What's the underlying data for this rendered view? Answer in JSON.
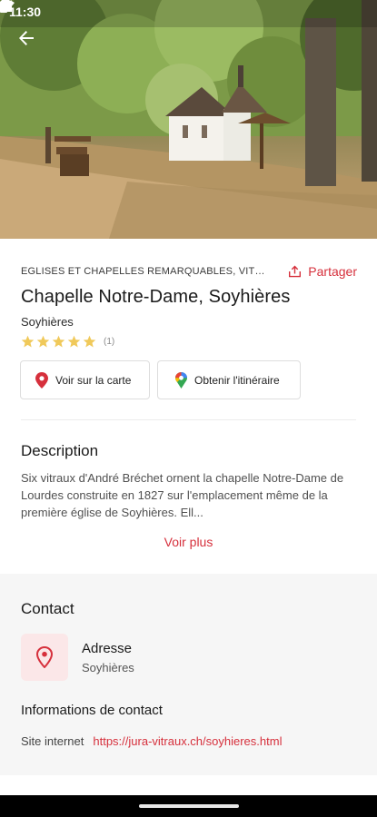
{
  "status_bar": {
    "time": "11:30",
    "icons": [
      "location-icon",
      "wifi-icon",
      "signal-icon",
      "battery-icon"
    ]
  },
  "hero": {
    "image_description_icon": "chapel-photo"
  },
  "place": {
    "category": "EGLISES ET CHAPELLES REMARQUABLES, VITRA...",
    "share_label": "Partager",
    "title": "Chapelle Notre-Dame, Soyhières",
    "locality": "Soyhières",
    "rating": {
      "value": 5,
      "max": 5,
      "count": "(1)"
    }
  },
  "actions": {
    "map_label": "Voir sur la carte",
    "route_label": "Obtenir l'itinéraire"
  },
  "description": {
    "heading": "Description",
    "text": "Six vitraux d'André Bréchet ornent la chapelle Notre-Dame de Lourdes construite en 1827 sur l'emplacement même de la première église de Soyhières. Ell...",
    "more_label": "Voir plus"
  },
  "contact": {
    "heading": "Contact",
    "address_label": "Adresse",
    "address_value": "Soyhières",
    "info_heading": "Informations de contact",
    "site_label": "Site internet",
    "site_url": "https://jura-vitraux.ch/soyhieres.html"
  },
  "colors": {
    "accent": "#d6303c",
    "star": "#f0c95a",
    "contact_bg": "#f6f6f6"
  }
}
